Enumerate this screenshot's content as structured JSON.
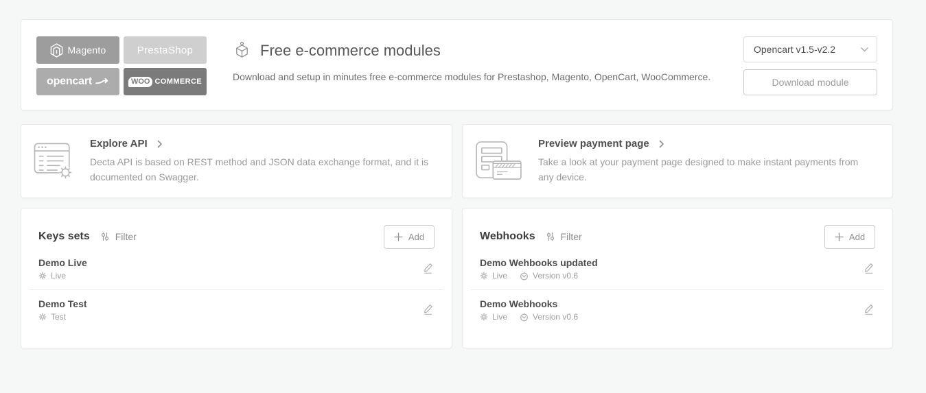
{
  "modules_card": {
    "logos": [
      {
        "name": "Magento",
        "bg": "#9d9d9d"
      },
      {
        "name": "PrestaShop",
        "bg": "#cfcfcf"
      },
      {
        "name": "opencart",
        "bg": "#acacac"
      },
      {
        "name": "WooCommerce",
        "badge": "WOO",
        "rest": "COMMERCE",
        "bg": "#7b7b7b"
      }
    ],
    "title": "Free e-commerce modules",
    "description": "Download and setup in minutes free e-commerce modules for Prestashop, Magento, OpenCart, WooCommerce.",
    "version_select": {
      "value": "Opencart v1.5-v2.2"
    },
    "download_button": "Download module"
  },
  "explore_api_card": {
    "title": "Explore API",
    "description": "Decta API is based on REST method and JSON data exchange format, and it is documented on Swagger."
  },
  "preview_payment_card": {
    "title": "Preview payment page",
    "description": "Take a look at your payment page designed to make instant payments from any device."
  },
  "keys_card": {
    "title": "Keys sets",
    "filter_label": "Filter",
    "add_label": "Add",
    "items": [
      {
        "name": "Demo Live",
        "environment": "Live"
      },
      {
        "name": "Demo Test",
        "environment": "Test"
      }
    ]
  },
  "webhooks_card": {
    "title": "Webhooks",
    "filter_label": "Filter",
    "add_label": "Add",
    "items": [
      {
        "name": "Demo Wehbooks updated",
        "environment": "Live",
        "version": "Version v0.6"
      },
      {
        "name": "Demo Webhooks",
        "environment": "Live",
        "version": "Version v0.6"
      }
    ]
  },
  "colors": {
    "page_background": "#f6f7f7",
    "card_border": "#e9e9e9",
    "muted_text": "#9a9a9a",
    "dark_text": "#3f3f3f"
  }
}
